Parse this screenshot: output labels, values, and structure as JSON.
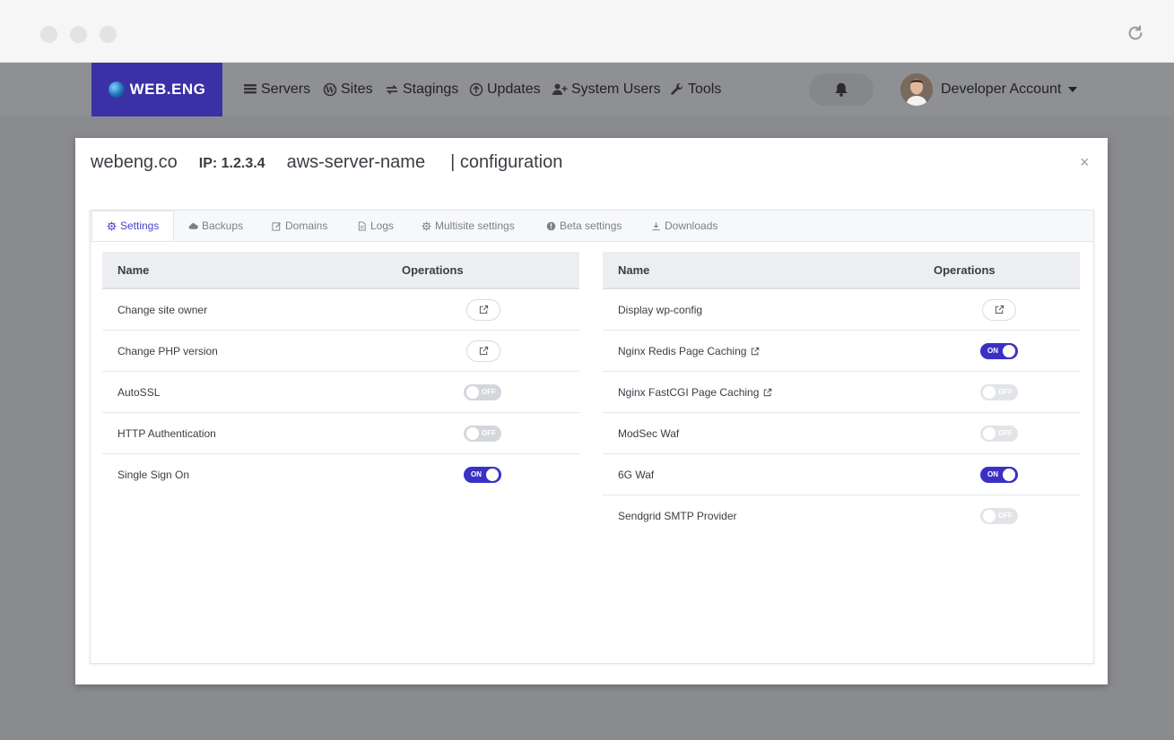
{
  "navbar": {
    "brand": "WEB.ENG",
    "items": [
      {
        "label": "Servers",
        "icon": "server-list-icon"
      },
      {
        "label": "Sites",
        "icon": "wordpress-icon"
      },
      {
        "label": "Stagings",
        "icon": "sync-icon"
      },
      {
        "label": "Updates",
        "icon": "upload-icon"
      },
      {
        "label": "System Users",
        "icon": "user-plus-icon"
      },
      {
        "label": "Tools",
        "icon": "wrench-icon"
      }
    ],
    "account": "Developer Account"
  },
  "modal": {
    "site": "webeng.co",
    "ip": "IP: 1.2.3.4",
    "server": "aws-server-name",
    "section": "| configuration",
    "close": "×"
  },
  "tabs": [
    {
      "label": "Settings",
      "icon": "gear-icon",
      "active": true
    },
    {
      "label": "Backups",
      "icon": "cloud-icon",
      "active": false
    },
    {
      "label": "Domains",
      "icon": "edit-icon",
      "active": false
    },
    {
      "label": "Logs",
      "icon": "document-icon",
      "active": false
    },
    {
      "label": "Multisite settings",
      "icon": "gear-icon",
      "active": false
    },
    {
      "label": "Beta settings",
      "icon": "info-icon",
      "active": false
    },
    {
      "label": "Downloads",
      "icon": "download-icon",
      "active": false
    }
  ],
  "tables": [
    {
      "col_name": "Name",
      "col_ops": "Operations",
      "rows": [
        {
          "name": "Change site owner",
          "op": "link"
        },
        {
          "name": "Change PHP version",
          "op": "link"
        },
        {
          "name": "AutoSSL",
          "op": "toggle",
          "state": "OFF"
        },
        {
          "name": "HTTP Authentication",
          "op": "toggle",
          "state": "OFF"
        },
        {
          "name": "Single Sign On",
          "op": "toggle",
          "state": "ON"
        }
      ]
    },
    {
      "col_name": "Name",
      "col_ops": "Operations",
      "rows": [
        {
          "name": "Display wp-config",
          "op": "link"
        },
        {
          "name": "Nginx Redis Page Caching",
          "op": "toggle",
          "state": "ON",
          "ext": true
        },
        {
          "name": "Nginx FastCGI Page Caching",
          "op": "toggle",
          "state": "OFF",
          "ext": true
        },
        {
          "name": "ModSec Waf",
          "op": "toggle",
          "state": "OFF"
        },
        {
          "name": "6G Waf",
          "op": "toggle",
          "state": "ON"
        },
        {
          "name": "Sendgrid SMTP Provider",
          "op": "toggle",
          "state": "OFF"
        }
      ]
    }
  ],
  "colors": {
    "accent": "#3a31c4",
    "brand_bg": "#3a31a6"
  }
}
